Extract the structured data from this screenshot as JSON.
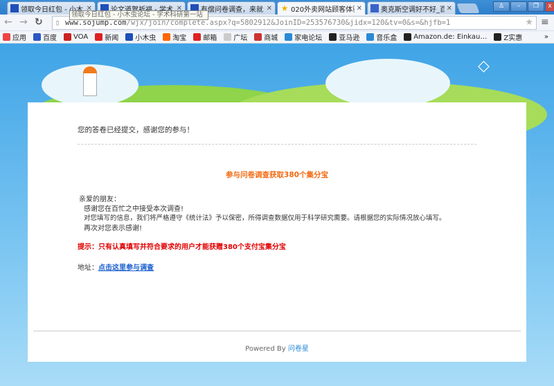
{
  "browser": {
    "tabs": [
      {
        "title": "领取今日红包 - 小木",
        "active": false
      },
      {
        "title": "论文道贺祈福 - 学术",
        "active": false
      },
      {
        "title": "有偿问卷调查，来就",
        "active": false
      },
      {
        "title": "020外卖网站顾客体验",
        "active": true
      },
      {
        "title": "奥克斯空调好不好_百",
        "active": false
      }
    ],
    "tooltip": "领取今日红包 - 小木虫论坛 - 学术科研第一站",
    "url_host": "www.sojump.com",
    "url_path": "/wjx/join/complete.aspx?q=5802912&JoinID=253576730&jidx=120&tv=0&s=&hjfb=1",
    "bookmarks": [
      {
        "label": "应用",
        "color": "#e44"
      },
      {
        "label": "百度",
        "color": "#2a56c6"
      },
      {
        "label": "VOA",
        "color": "#c22"
      },
      {
        "label": "新闻",
        "color": "#d22"
      },
      {
        "label": "小木虫",
        "color": "#1f4fb8"
      },
      {
        "label": "淘宝",
        "color": "#f60"
      },
      {
        "label": "邮箱",
        "color": "#d22"
      },
      {
        "label": "广坛",
        "color": "#ccc"
      },
      {
        "label": "商城",
        "color": "#c33"
      },
      {
        "label": "家电论坛",
        "color": "#2a8ad6"
      },
      {
        "label": "亚马逊",
        "color": "#222"
      },
      {
        "label": "音乐盒",
        "color": "#2a8ad6"
      },
      {
        "label": "Amazon.de: Einkau…",
        "color": "#222"
      },
      {
        "label": "Z实惠",
        "color": "#222"
      }
    ],
    "more_bookmarks": "»"
  },
  "content": {
    "submitted": "您的答卷已经提交，感谢您的参与！",
    "headline": "参与问卷调查获取380个集分宝",
    "greeting": "亲爱的朋友：",
    "lines": [
      "感谢您在百忙之中接受本次调查!",
      "对您填写的信息，我们将严格遵守《统计法》予以保密，所得调查数据仅用于科学研究需要。请根据您的实际情况放心填写。",
      "再次对您表示感谢!"
    ],
    "tip": "提示：只有认真填写并符合要求的用户才能获赠380个支付宝集分宝",
    "address_label": "地址：",
    "address_link": "点击这里参与调查",
    "powered_by": "Powered By",
    "brand": "问卷星"
  },
  "colors": {
    "headline": "#f26a10",
    "tip": "#e00000",
    "link": "#1a5fd0"
  }
}
